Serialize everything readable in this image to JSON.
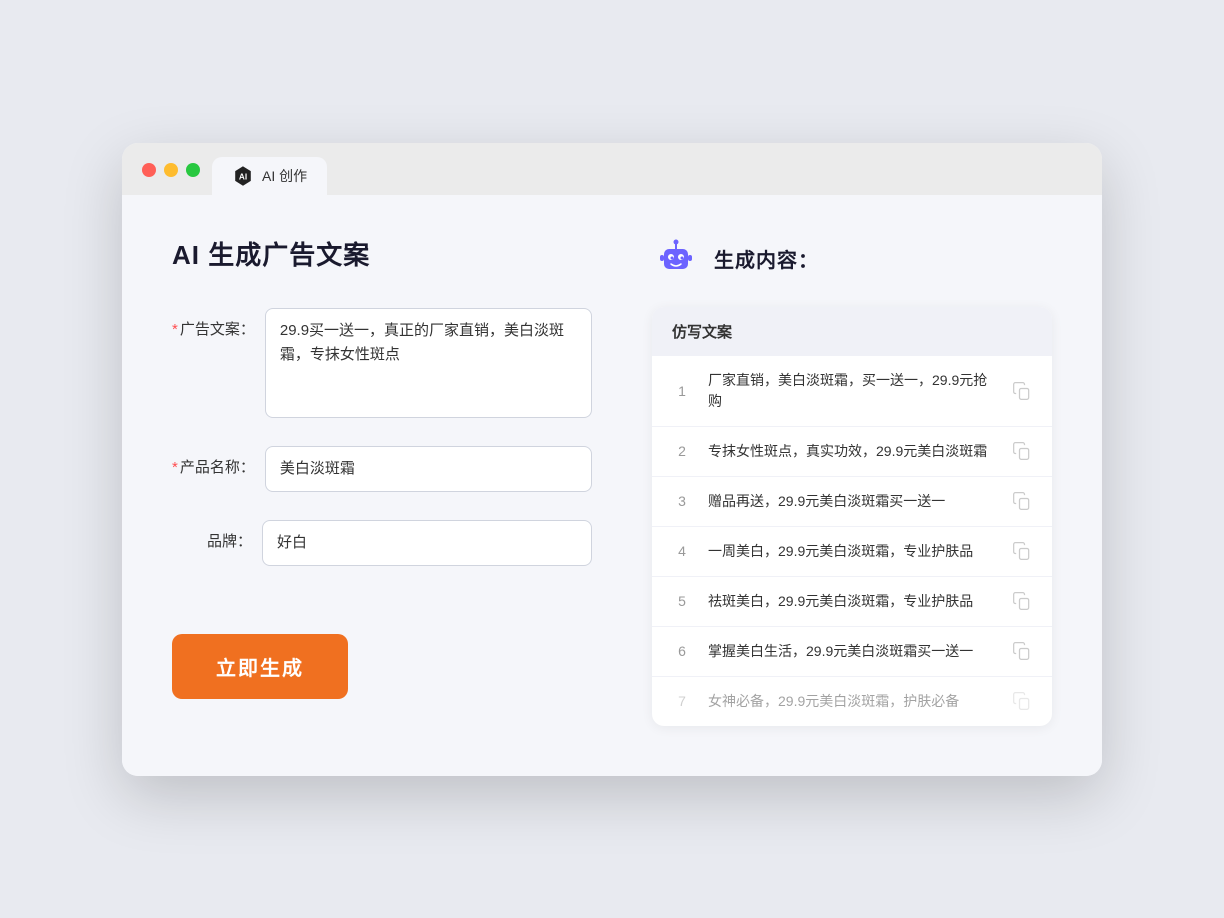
{
  "tab": {
    "label": "AI 创作"
  },
  "page": {
    "title": "AI 生成广告文案"
  },
  "form": {
    "ad_label": "广告文案：",
    "ad_required": "*",
    "ad_value": "29.9买一送一，真正的厂家直销，美白淡斑霜，专抹女性斑点",
    "product_label": "产品名称：",
    "product_required": "*",
    "product_value": "美白淡斑霜",
    "brand_label": "品牌：",
    "brand_value": "好白",
    "submit_label": "立即生成"
  },
  "result": {
    "header": "生成内容：",
    "table_col": "仿写文案",
    "items": [
      {
        "id": 1,
        "text": "厂家直销，美白淡斑霜，买一送一，29.9元抢购",
        "faded": false
      },
      {
        "id": 2,
        "text": "专抹女性斑点，真实功效，29.9元美白淡斑霜",
        "faded": false
      },
      {
        "id": 3,
        "text": "赠品再送，29.9元美白淡斑霜买一送一",
        "faded": false
      },
      {
        "id": 4,
        "text": "一周美白，29.9元美白淡斑霜，专业护肤品",
        "faded": false
      },
      {
        "id": 5,
        "text": "祛斑美白，29.9元美白淡斑霜，专业护肤品",
        "faded": false
      },
      {
        "id": 6,
        "text": "掌握美白生活，29.9元美白淡斑霜买一送一",
        "faded": false
      },
      {
        "id": 7,
        "text": "女神必备，29.9元美白淡斑霜，护肤必备",
        "faded": true
      }
    ]
  }
}
